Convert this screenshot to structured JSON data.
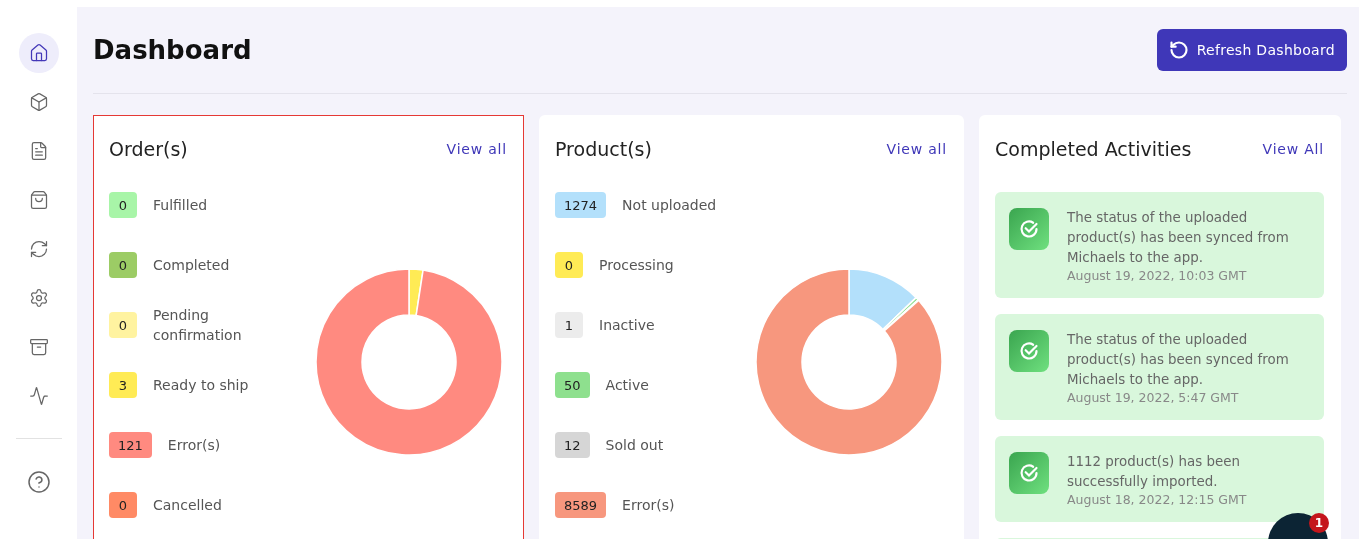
{
  "sidebar": {
    "items": [
      {
        "selected": true
      },
      {
        "selected": false
      },
      {
        "selected": false
      },
      {
        "selected": false
      },
      {
        "selected": false
      },
      {
        "selected": false
      },
      {
        "selected": false
      },
      {
        "selected": false
      }
    ],
    "footer_items": [
      {
        "selected": false
      }
    ]
  },
  "header": {
    "title": "Dashboard",
    "refresh_button": "Refresh Dashboard"
  },
  "orders": {
    "title": "Order(s)",
    "link": "View all",
    "outlined": true,
    "items": [
      {
        "count": "0",
        "label": "Fulfilled",
        "color": "#a8f5a8"
      },
      {
        "count": "0",
        "label": "Completed",
        "color": "#9ccc65"
      },
      {
        "count": "0",
        "label": "Pending confirmation",
        "color": "#fff3a0"
      },
      {
        "count": "3",
        "label": "Ready to ship",
        "color": "#ffeb55"
      },
      {
        "count": "121",
        "label": "Error(s)",
        "color": "#ff8a80"
      },
      {
        "count": "0",
        "label": "Cancelled",
        "color": "#ff8a65"
      }
    ]
  },
  "products": {
    "title": "Product(s)",
    "link": "View all",
    "outlined": false,
    "items": [
      {
        "count": "1274",
        "label": "Not uploaded",
        "color": "#b3e0fb"
      },
      {
        "count": "0",
        "label": "Processing",
        "color": "#ffeb55"
      },
      {
        "count": "1",
        "label": "Inactive",
        "color": "#ececec"
      },
      {
        "count": "50",
        "label": "Active",
        "color": "#8ee08e"
      },
      {
        "count": "12",
        "label": "Sold out",
        "color": "#d6d6d6"
      },
      {
        "count": "8589",
        "label": "Error(s)",
        "color": "#f7977e"
      }
    ]
  },
  "activities": {
    "title": "Completed Activities",
    "link": "View All",
    "items": [
      {
        "kind": "entry",
        "text": "The status of the uploaded product(s) has been synced from Michaels to the app.",
        "time": "August 19, 2022, 10:03 GMT"
      },
      {
        "kind": "entry",
        "text": "The status of the uploaded product(s) has been synced from Michaels to the app.",
        "time": "August 19, 2022, 5:47 GMT"
      },
      {
        "kind": "entry",
        "text": "1112 product(s) has been successfully imported.",
        "time": "August 18, 2022, 12:15 GMT"
      },
      {
        "kind": "cut"
      }
    ]
  },
  "chat": {
    "badge": "1"
  }
}
